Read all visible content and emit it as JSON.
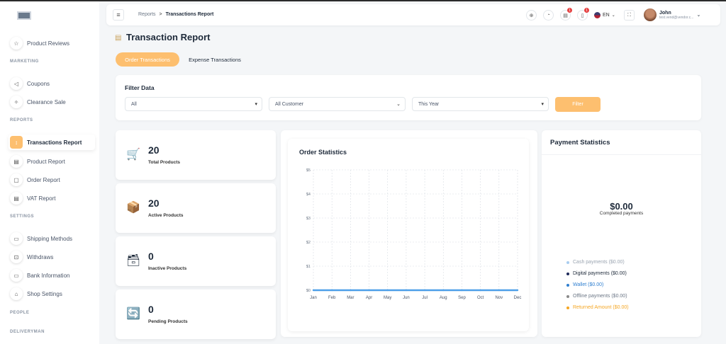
{
  "sidebar": {
    "items": [
      {
        "label": "Product Reviews",
        "icon": "star-icon"
      },
      {
        "label": "Coupons",
        "icon": "coupon-icon"
      },
      {
        "label": "Clearance Sale",
        "icon": "sparkle-icon"
      },
      {
        "label": "Transactions Report",
        "icon": "transaction-icon"
      },
      {
        "label": "Product Report",
        "icon": "document-icon"
      },
      {
        "label": "Order Report",
        "icon": "order-icon"
      },
      {
        "label": "VAT Report",
        "icon": "vat-icon"
      },
      {
        "label": "Shipping Methods",
        "icon": "truck-icon"
      },
      {
        "label": "Withdraws",
        "icon": "withdraw-icon"
      },
      {
        "label": "Bank Information",
        "icon": "bank-icon"
      },
      {
        "label": "Shop Settings",
        "icon": "shop-icon"
      }
    ],
    "sections": {
      "marketing": "MARKETING",
      "reports": "REPORTS",
      "settings": "SETTINGS",
      "people": "PEOPLE",
      "deliveryman": "DELIVERYMAN"
    }
  },
  "header": {
    "breadcrumb_parent": "Reports",
    "breadcrumb_sep": ">",
    "breadcrumb_current": "Transactions Report",
    "messages_badge": "1",
    "cart_badge": "1",
    "language": "EN",
    "user_name": "John",
    "user_email": "test.vend@vendor.c..."
  },
  "page": {
    "title": "Transaction Report"
  },
  "tabs": {
    "order": "Order Transactions",
    "expense": "Expense Transactions"
  },
  "filter": {
    "title": "Filter Data",
    "type_value": "All",
    "customer_value": "All Customer",
    "period_value": "This Year",
    "button": "Filter"
  },
  "stats": [
    {
      "value": "20",
      "label": "Total Products"
    },
    {
      "value": "20",
      "label": "Active Products"
    },
    {
      "value": "0",
      "label": "Inactive Products"
    },
    {
      "value": "0",
      "label": "Pending Products"
    }
  ],
  "chart_data": {
    "type": "line",
    "title": "Order Statistics",
    "categories": [
      "Jan",
      "Feb",
      "Mar",
      "Apr",
      "May",
      "Jun",
      "Jul",
      "Aug",
      "Sep",
      "Oct",
      "Nov",
      "Dec"
    ],
    "series": [
      {
        "values": [
          0,
          0,
          0,
          0,
          0,
          0,
          0,
          0,
          0,
          0,
          0,
          0
        ],
        "color": "#4d9fe8"
      }
    ],
    "ylim": [
      0,
      5
    ],
    "yticks": [
      "$0",
      "$1",
      "$2",
      "$3",
      "$4",
      "$5"
    ],
    "grid": true
  },
  "payment": {
    "title": "Payment Statistics",
    "amount": "$0.00",
    "amount_label": "Completed payments",
    "legend": [
      {
        "label": "Cash payments ($0.00)",
        "color": "#a9cdf0",
        "text_color": "#9aa4b0"
      },
      {
        "label": "Digital payments ($0.00)",
        "color": "#1e2a5a",
        "text_color": "#1e2a3a"
      },
      {
        "label": "Wallet ($0.00)",
        "color": "#2f7fd0",
        "text_color": "#2f7fd0"
      },
      {
        "label": "Offline payments ($0.00)",
        "color": "#8a8a8a",
        "text_color": "#6b7685"
      },
      {
        "label": "Returned Amount ($0.00)",
        "color": "#f5a623",
        "text_color": "#f5a623"
      }
    ]
  }
}
